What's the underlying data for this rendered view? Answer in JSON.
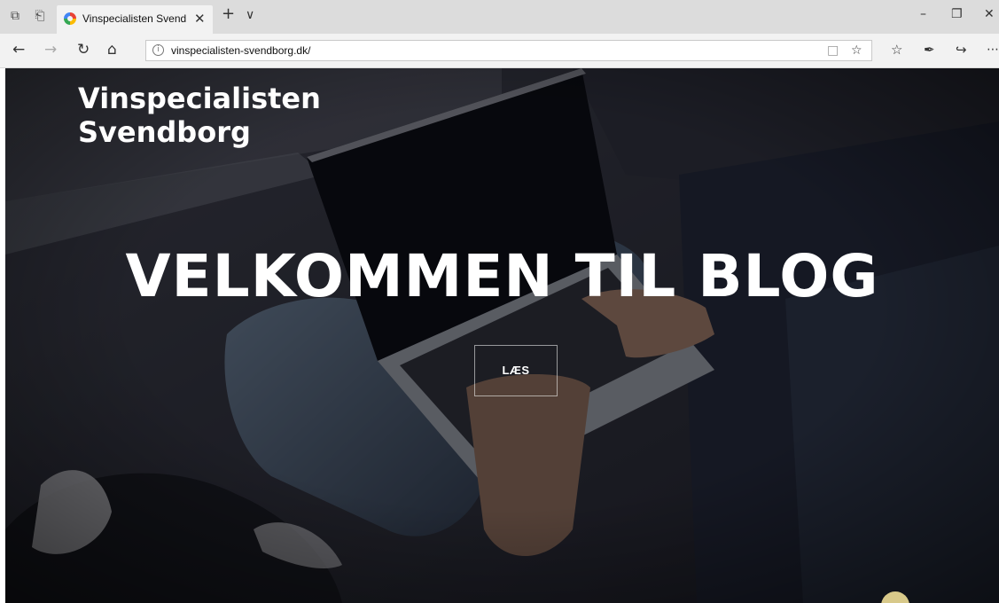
{
  "browser": {
    "tab": {
      "title": "Vinspecialisten Svendbc",
      "close_icon": "close-icon"
    },
    "tab_icons": [
      "tabs-aside-icon",
      "set-tabs-aside-icon"
    ],
    "new_tab_icon": "plus-icon",
    "tab_menu_icon": "chevron-down-icon",
    "window_controls": [
      "minimize-icon",
      "restore-icon",
      "close-icon"
    ],
    "nav": {
      "back_icon": "arrow-left-icon",
      "forward_icon": "arrow-right-icon",
      "refresh_icon": "refresh-icon",
      "home_icon": "home-icon"
    },
    "address": {
      "url": "vinspecialisten-svendborg.dk/",
      "info_icon": "info-icon",
      "reading_view_icon": "book-icon",
      "favorite_icon": "star-icon"
    },
    "toolbar_icons": [
      "favorites-list-icon",
      "pen-icon",
      "share-icon",
      "more-icon"
    ]
  },
  "page": {
    "brand": {
      "line1": "Vinspecialisten",
      "line2": "Svendborg"
    },
    "hero_heading": "VELKOMMEN TIL BLOG",
    "read_button": "LÆS"
  }
}
